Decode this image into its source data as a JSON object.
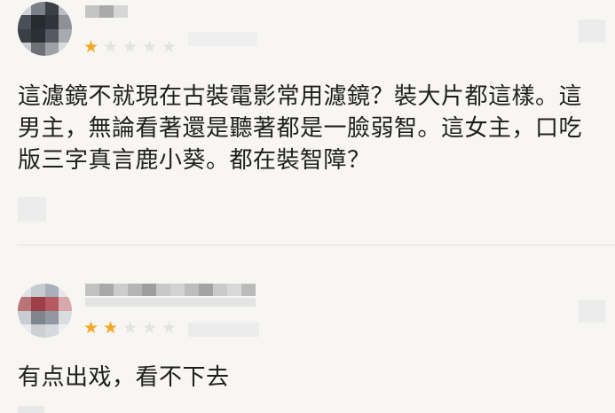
{
  "reviews": [
    {
      "rating": 1,
      "max_rating": 5,
      "text": "這濾鏡不就現在古裝電影常用濾鏡？裝大片都這樣。這男主，無論看著還是聽著都是一臉弱智。這女主，口吃版三字真言鹿小葵。都在裝智障？"
    },
    {
      "rating": 2,
      "max_rating": 5,
      "text": "有点出戏，看不下去"
    }
  ],
  "colors": {
    "background": "#f7f6f2",
    "star_filled": "#f5a623",
    "star_empty": "#e3e3e3",
    "text": "#1f1f1f",
    "divider": "#e2e1dc"
  },
  "icons": {
    "star_filled": "star-filled-icon",
    "star_empty": "star-empty-icon"
  }
}
